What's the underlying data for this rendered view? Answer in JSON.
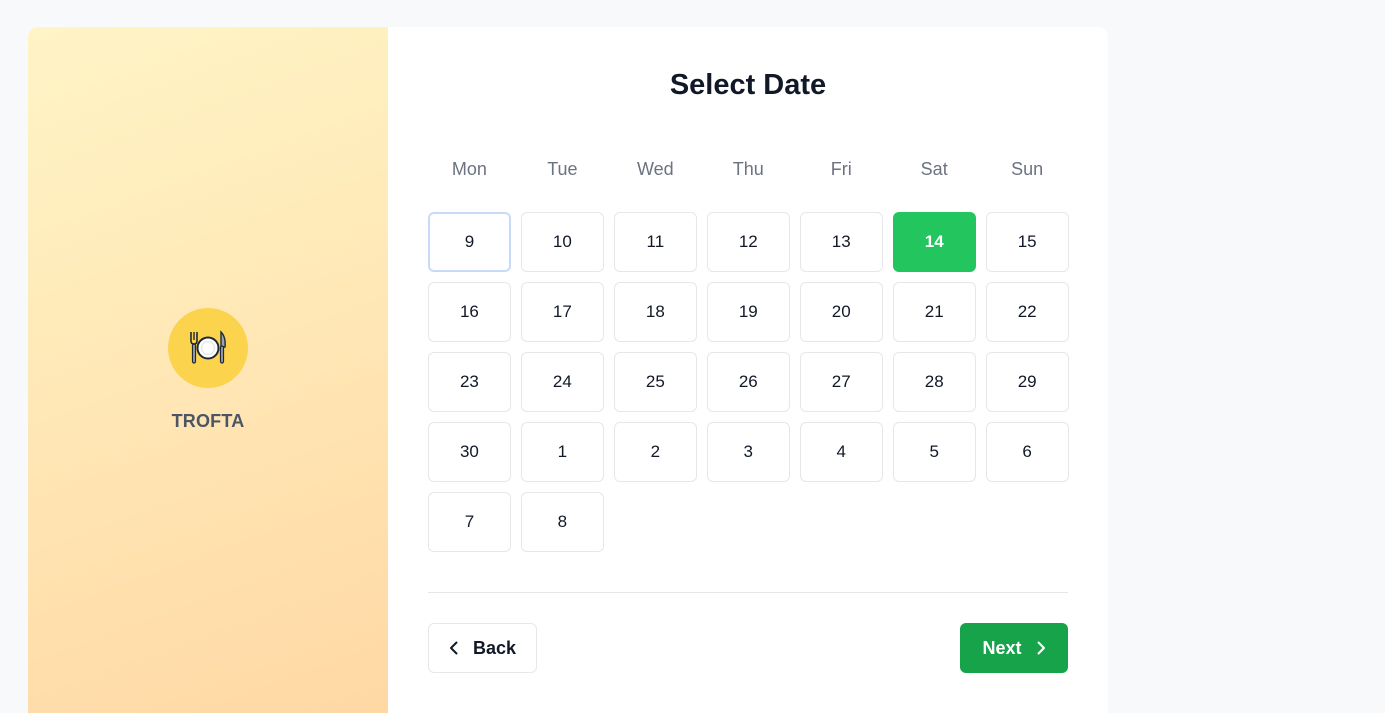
{
  "brand": {
    "name": "TROFTA",
    "logo_icon": "fork-knife-plate-icon",
    "logo_bg": "#fcd34d"
  },
  "page": {
    "title": "Select Date"
  },
  "calendar": {
    "weekdays": [
      "Mon",
      "Tue",
      "Wed",
      "Thu",
      "Fri",
      "Sat",
      "Sun"
    ],
    "days": [
      {
        "label": "9",
        "state": "today"
      },
      {
        "label": "10"
      },
      {
        "label": "11"
      },
      {
        "label": "12"
      },
      {
        "label": "13"
      },
      {
        "label": "14",
        "state": "selected"
      },
      {
        "label": "15"
      },
      {
        "label": "16"
      },
      {
        "label": "17"
      },
      {
        "label": "18"
      },
      {
        "label": "19"
      },
      {
        "label": "20"
      },
      {
        "label": "21"
      },
      {
        "label": "22"
      },
      {
        "label": "23"
      },
      {
        "label": "24"
      },
      {
        "label": "25"
      },
      {
        "label": "26"
      },
      {
        "label": "27"
      },
      {
        "label": "28"
      },
      {
        "label": "29"
      },
      {
        "label": "30"
      },
      {
        "label": "1"
      },
      {
        "label": "2"
      },
      {
        "label": "3"
      },
      {
        "label": "4"
      },
      {
        "label": "5"
      },
      {
        "label": "6"
      },
      {
        "label": "7"
      },
      {
        "label": "8"
      }
    ],
    "selected_color": "#22c55e"
  },
  "footer": {
    "back_label": "Back",
    "back_icon": "chevron-left-icon",
    "next_label": "Next",
    "next_icon": "chevron-right-icon",
    "next_color": "#16a34a"
  }
}
